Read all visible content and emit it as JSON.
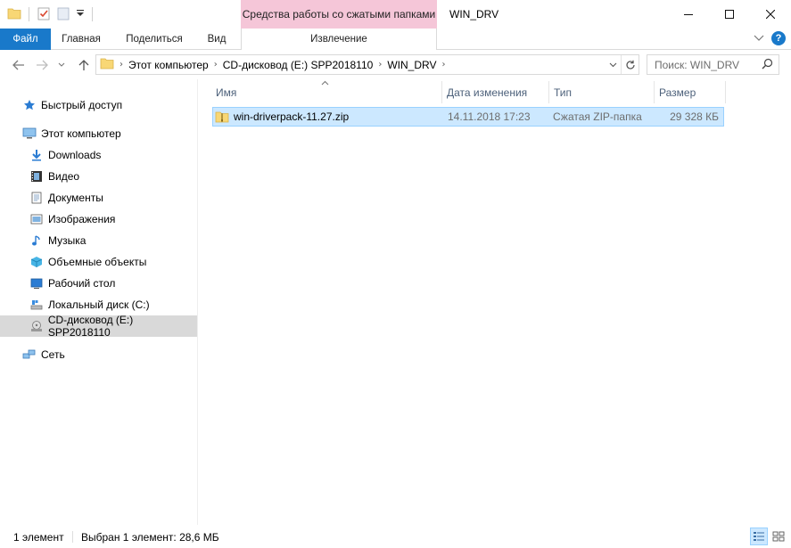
{
  "window": {
    "title": "WIN_DRV",
    "contextual_group": "Средства работы со сжатыми папками"
  },
  "ribbon": {
    "tabs": {
      "file": "Файл",
      "home": "Главная",
      "share": "Поделиться",
      "view": "Вид",
      "extract": "Извлечение"
    }
  },
  "address": {
    "crumbs": [
      "Этот компьютер",
      "CD-дисковод (E:) SPP2018110",
      "WIN_DRV"
    ]
  },
  "search": {
    "placeholder": "Поиск: WIN_DRV"
  },
  "sidebar": {
    "quick_access": "Быстрый доступ",
    "this_pc": "Этот компьютер",
    "items": [
      "Downloads",
      "Видео",
      "Документы",
      "Изображения",
      "Музыка",
      "Объемные объекты",
      "Рабочий стол",
      "Локальный диск (C:)",
      "CD-дисковод (E:) SPP2018110"
    ],
    "network": "Сеть"
  },
  "list": {
    "columns": [
      "Имя",
      "Дата изменения",
      "Тип",
      "Размер"
    ],
    "rows": [
      {
        "name": "win-driverpack-11.27.zip",
        "date": "14.11.2018 17:23",
        "type": "Сжатая ZIP-папка",
        "size": "29 328 КБ"
      }
    ]
  },
  "status": {
    "count": "1 элемент",
    "selection": "Выбран 1 элемент: 28,6 МБ"
  },
  "colors": {
    "accent": "#1979ca",
    "selection_bg": "#cce8ff",
    "selection_border": "#99d1ff",
    "context_tab": "#f5c6d8"
  }
}
